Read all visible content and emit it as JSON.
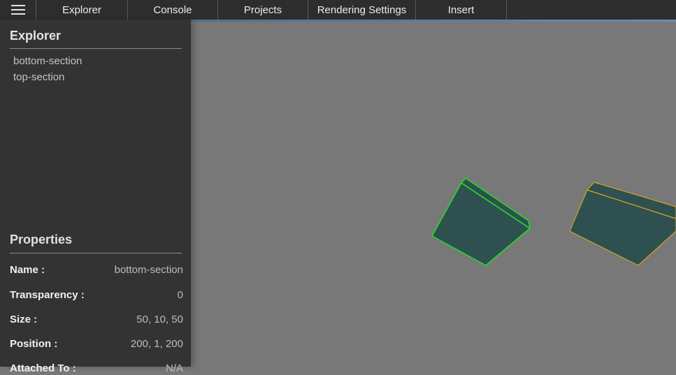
{
  "menubar": {
    "tabs": [
      {
        "label": "Explorer"
      },
      {
        "label": "Console"
      },
      {
        "label": "Projects"
      },
      {
        "label": "Rendering Settings"
      },
      {
        "label": "Insert"
      }
    ]
  },
  "explorer": {
    "title": "Explorer",
    "items": [
      {
        "label": "bottom-section"
      },
      {
        "label": "top-section"
      }
    ]
  },
  "properties": {
    "title": "Properties",
    "rows": [
      {
        "label": "Name :",
        "value": "bottom-section"
      },
      {
        "label": "Transparency :",
        "value": "0"
      },
      {
        "label": "Size :",
        "value": "50, 10, 50"
      },
      {
        "label": "Position :",
        "value": "200, 1, 200"
      },
      {
        "label": "Attached To :",
        "value": "N/A"
      }
    ]
  },
  "viewport": {
    "selected_object": "bottom-section",
    "other_object": "top-section",
    "colors": {
      "background": "#787878",
      "object_fill": "#2e5050",
      "selected_outline": "#22e022",
      "other_outline": "#d4a020"
    }
  }
}
